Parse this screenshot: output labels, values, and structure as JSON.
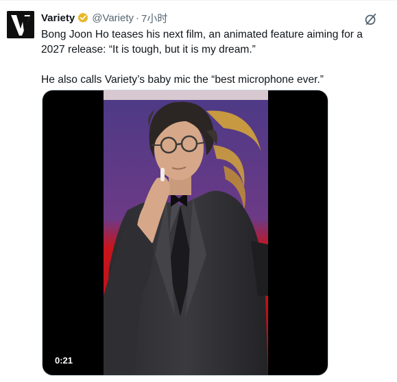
{
  "tweet": {
    "author_name": "Variety",
    "handle": "@Variety",
    "separator": "·",
    "time": "7小时",
    "paragraphs": [
      "Bong Joon Ho teases his next film, an animated feature aiming for a 2027 release: “It is tough, but it is my dream.”",
      "He also calls Variety’s baby mic the “best microphone ever.”"
    ]
  },
  "media": {
    "duration": "0:21"
  },
  "icons": {
    "avatar": "variety-logo",
    "verified": "verified-badge-icon",
    "grok": "grok-icon"
  },
  "colors": {
    "verified_gold": "#e8b829",
    "secondary_text": "#536471",
    "video_background": "#000000",
    "stage_red": "#c8141c",
    "stage_purple": "#5a3d8a",
    "logo_gold": "#d4a43a"
  }
}
